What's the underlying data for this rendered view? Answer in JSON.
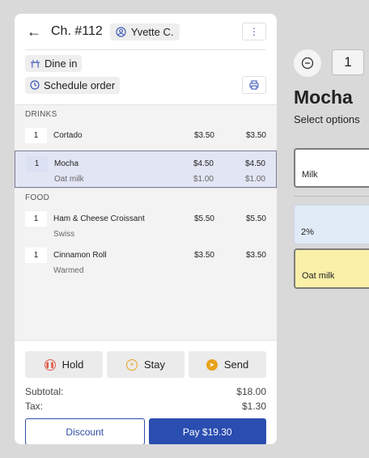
{
  "header": {
    "back_icon": "arrow-left-icon",
    "check_title": "Ch. #112",
    "guest_name": "Yvette C.",
    "more_icon": "more-vertical-icon",
    "dine_in": "Dine in",
    "schedule": "Schedule order",
    "print_icon": "print-icon"
  },
  "sections": {
    "drinks": "DRINKS",
    "food": "FOOD"
  },
  "items": [
    {
      "qty": "1",
      "name": "Cortado",
      "price": "$3.50",
      "total": "$3.50"
    },
    {
      "qty": "1",
      "name": "Mocha",
      "price": "$4.50",
      "total": "$4.50",
      "mod": "Oat milk",
      "mod_price": "$1.00",
      "mod_total": "$1.00",
      "selected": true
    },
    {
      "qty": "1",
      "name": "Ham & Cheese Croissant",
      "price": "$5.50",
      "total": "$5.50",
      "mod": "Swiss"
    },
    {
      "qty": "1",
      "name": "Cinnamon Roll",
      "price": "$3.50",
      "total": "$3.50",
      "mod": "Warmed"
    }
  ],
  "actions": {
    "hold": "Hold",
    "stay": "Stay",
    "send": "Send"
  },
  "totals": {
    "subtotal_label": "Subtotal:",
    "subtotal": "$18.00",
    "tax_label": "Tax:",
    "tax": "$1.30"
  },
  "buttons": {
    "discount": "Discount",
    "pay": "Pay $19.30"
  },
  "panel": {
    "qty": "1",
    "title": "Mocha",
    "subtitle": "Select options",
    "options": {
      "milk": "Milk",
      "two_percent": "2%",
      "oat": "Oat milk"
    }
  },
  "colors": {
    "primary": "#2a4db0",
    "hold_accent": "#e05a4a",
    "stay_accent": "#e9a219",
    "send_accent": "#e9a219",
    "selected_row": "#e2e5f4",
    "oat_option": "#fbf0a8",
    "two_percent_option": "#e1eaf7"
  }
}
